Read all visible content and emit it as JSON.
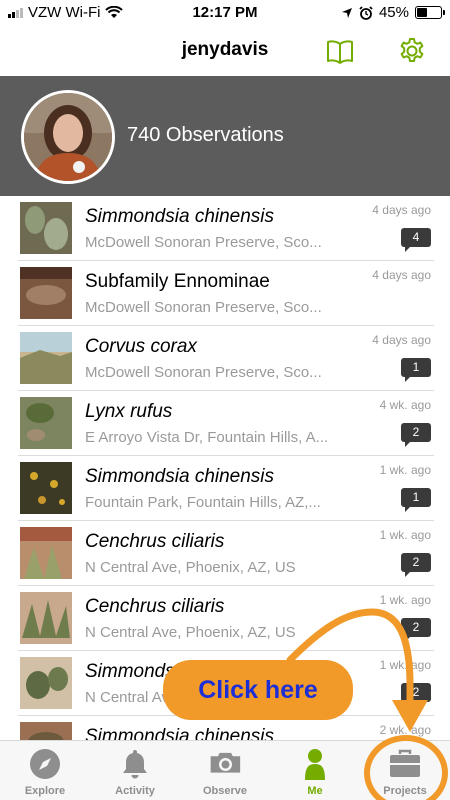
{
  "status_bar": {
    "carrier": "VZW Wi-Fi",
    "time": "12:17 PM",
    "battery": "45%",
    "battery_level": 0.45
  },
  "nav": {
    "title": "jenydavis",
    "icons": [
      "book-icon",
      "gear-icon"
    ],
    "accent_color": "#74ac00"
  },
  "profile": {
    "observations_label": "740 Observations"
  },
  "observations": [
    {
      "name": "Simmondsia chinensis",
      "italic": true,
      "place": "McDowell Sonoran Preserve, Sco...",
      "time": "4 days ago",
      "comments": "4"
    },
    {
      "name": "Subfamily Ennominae",
      "italic": false,
      "place": "McDowell Sonoran Preserve, Sco...",
      "time": "4 days ago",
      "comments": ""
    },
    {
      "name": "Corvus corax",
      "italic": true,
      "place": "McDowell Sonoran Preserve, Sco...",
      "time": "4 days ago",
      "comments": "1"
    },
    {
      "name": "Lynx rufus",
      "italic": true,
      "place": "E Arroyo Vista Dr, Fountain Hills, A...",
      "time": "4 wk. ago",
      "comments": "2"
    },
    {
      "name": "Simmondsia chinensis",
      "italic": true,
      "place": "Fountain Park, Fountain Hills, AZ,...",
      "time": "1 wk. ago",
      "comments": "1"
    },
    {
      "name": "Cenchrus ciliaris",
      "italic": true,
      "place": "N Central Ave, Phoenix, AZ, US",
      "time": "1 wk. ago",
      "comments": "2"
    },
    {
      "name": "Cenchrus ciliaris",
      "italic": true,
      "place": "N Central Ave, Phoenix, AZ, US",
      "time": "1 wk. ago",
      "comments": "2"
    },
    {
      "name": "Simmondsia chinensis",
      "italic": true,
      "place": "N Central Ave, Phoenix, AZ, US",
      "time": "1 wk. ago",
      "comments": "2"
    },
    {
      "name": "Simmondsia chinensis",
      "italic": true,
      "place": "",
      "time": "2 wk. ago",
      "comments": ""
    }
  ],
  "tabs": [
    {
      "label": "Explore",
      "icon": "compass-icon",
      "active": false
    },
    {
      "label": "Activity",
      "icon": "bell-icon",
      "active": false
    },
    {
      "label": "Observe",
      "icon": "camera-icon",
      "active": false
    },
    {
      "label": "Me",
      "icon": "person-icon",
      "active": true
    },
    {
      "label": "Projects",
      "icon": "briefcase-icon",
      "active": false
    }
  ],
  "annotation": {
    "callout_text": "Click here",
    "color": "#f19a2a",
    "text_color": "#1c2fd6"
  }
}
